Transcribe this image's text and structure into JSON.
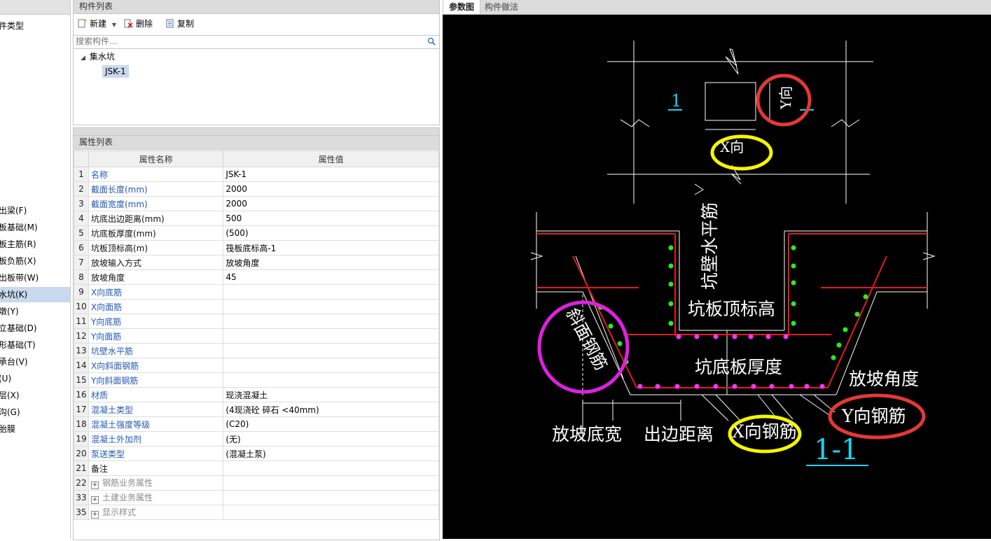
{
  "left_nav": {
    "items": [
      {
        "label": "件类型"
      },
      {
        "label": "出梁(F)"
      },
      {
        "label": "板基础(M)"
      },
      {
        "label": "板主筋(R)"
      },
      {
        "label": "板负筋(X)"
      },
      {
        "label": "出板带(W)"
      },
      {
        "label": "水坑(K)"
      },
      {
        "label": "墩(Y)"
      },
      {
        "label": "立基础(D)"
      },
      {
        "label": "形基础(T)"
      },
      {
        "label": "承台(V)"
      },
      {
        "label": "(U)"
      },
      {
        "label": "层(X)"
      },
      {
        "label": "沟(G)"
      },
      {
        "label": "胎膜"
      }
    ]
  },
  "component_list": {
    "title": "构件列表",
    "toolbar": {
      "new_label": "新建",
      "delete_label": "删除",
      "copy_label": "复制"
    },
    "search_placeholder": "搜索构件...",
    "tree": {
      "parent": "集水坑",
      "child": "JSK-1"
    }
  },
  "property_list": {
    "title": "属性列表",
    "col_name": "属性名称",
    "col_value": "属性值",
    "rows": [
      {
        "num": "1",
        "name": "名称",
        "value": "JSK-1",
        "style": "blue"
      },
      {
        "num": "2",
        "name": "截面长度(mm)",
        "value": "2000",
        "style": "blue"
      },
      {
        "num": "3",
        "name": "截面宽度(mm)",
        "value": "2000",
        "style": "blue"
      },
      {
        "num": "4",
        "name": "坑底出边距离(mm)",
        "value": "500",
        "style": "black"
      },
      {
        "num": "5",
        "name": "坑底板厚度(mm)",
        "value": "(500)",
        "style": "black"
      },
      {
        "num": "6",
        "name": "坑板顶标高(m)",
        "value": "筏板底标高-1",
        "style": "black"
      },
      {
        "num": "7",
        "name": "放坡输入方式",
        "value": "放坡角度",
        "style": "black"
      },
      {
        "num": "8",
        "name": "放坡角度",
        "value": "45",
        "style": "black"
      },
      {
        "num": "9",
        "name": "X向底筋",
        "value": "",
        "style": "blue"
      },
      {
        "num": "10",
        "name": "X向面筋",
        "value": "",
        "style": "blue"
      },
      {
        "num": "11",
        "name": "Y向底筋",
        "value": "",
        "style": "blue"
      },
      {
        "num": "12",
        "name": "Y向面筋",
        "value": "",
        "style": "blue"
      },
      {
        "num": "13",
        "name": "坑壁水平筋",
        "value": "",
        "style": "blue"
      },
      {
        "num": "14",
        "name": "X向斜面钢筋",
        "value": "",
        "style": "blue"
      },
      {
        "num": "15",
        "name": "Y向斜面钢筋",
        "value": "",
        "style": "blue"
      },
      {
        "num": "16",
        "name": "材质",
        "value": "现浇混凝土",
        "style": "blue"
      },
      {
        "num": "17",
        "name": "混凝土类型",
        "value": "(4现浇砼 碎石 <40mm)",
        "style": "blue"
      },
      {
        "num": "18",
        "name": "混凝土强度等级",
        "value": "(C20)",
        "style": "blue"
      },
      {
        "num": "19",
        "name": "混凝土外加剂",
        "value": "(无)",
        "style": "blue"
      },
      {
        "num": "20",
        "name": "泵送类型",
        "value": "(混凝土泵)",
        "style": "blue"
      },
      {
        "num": "21",
        "name": "备注",
        "value": "",
        "style": "black"
      },
      {
        "num": "22",
        "name": "钢筋业务属性",
        "value": "",
        "style": "group"
      },
      {
        "num": "33",
        "name": "土建业务属性",
        "value": "",
        "style": "group"
      },
      {
        "num": "35",
        "name": "显示样式",
        "value": "",
        "style": "group"
      }
    ]
  },
  "view_tabs": {
    "tab1": "参数图",
    "tab2": "构件做法"
  },
  "drawing": {
    "section_mark": "1",
    "y_dir": "Y向",
    "x_dir": "X向",
    "wall_horizontal_bar": "坑壁水平筋",
    "pit_top_elevation": "坑板顶标高",
    "slope_bar": "斜面钢筋",
    "bottom_thickness": "坑底板厚度",
    "slope_angle": "放坡角度",
    "y_bar": "Y向钢筋",
    "x_bar": "X向钢筋",
    "slope_bottom_width": "放坡底宽",
    "edge_distance": "出边距离",
    "section_title": "1-1",
    "colors": {
      "annot_red": "#e53935",
      "annot_yellow": "#f5f500",
      "annot_magenta": "#e020e0",
      "rebar_green": "#22ee22",
      "rebar_magenta": "#ff33ff",
      "cyan": "#19d3f0"
    }
  }
}
